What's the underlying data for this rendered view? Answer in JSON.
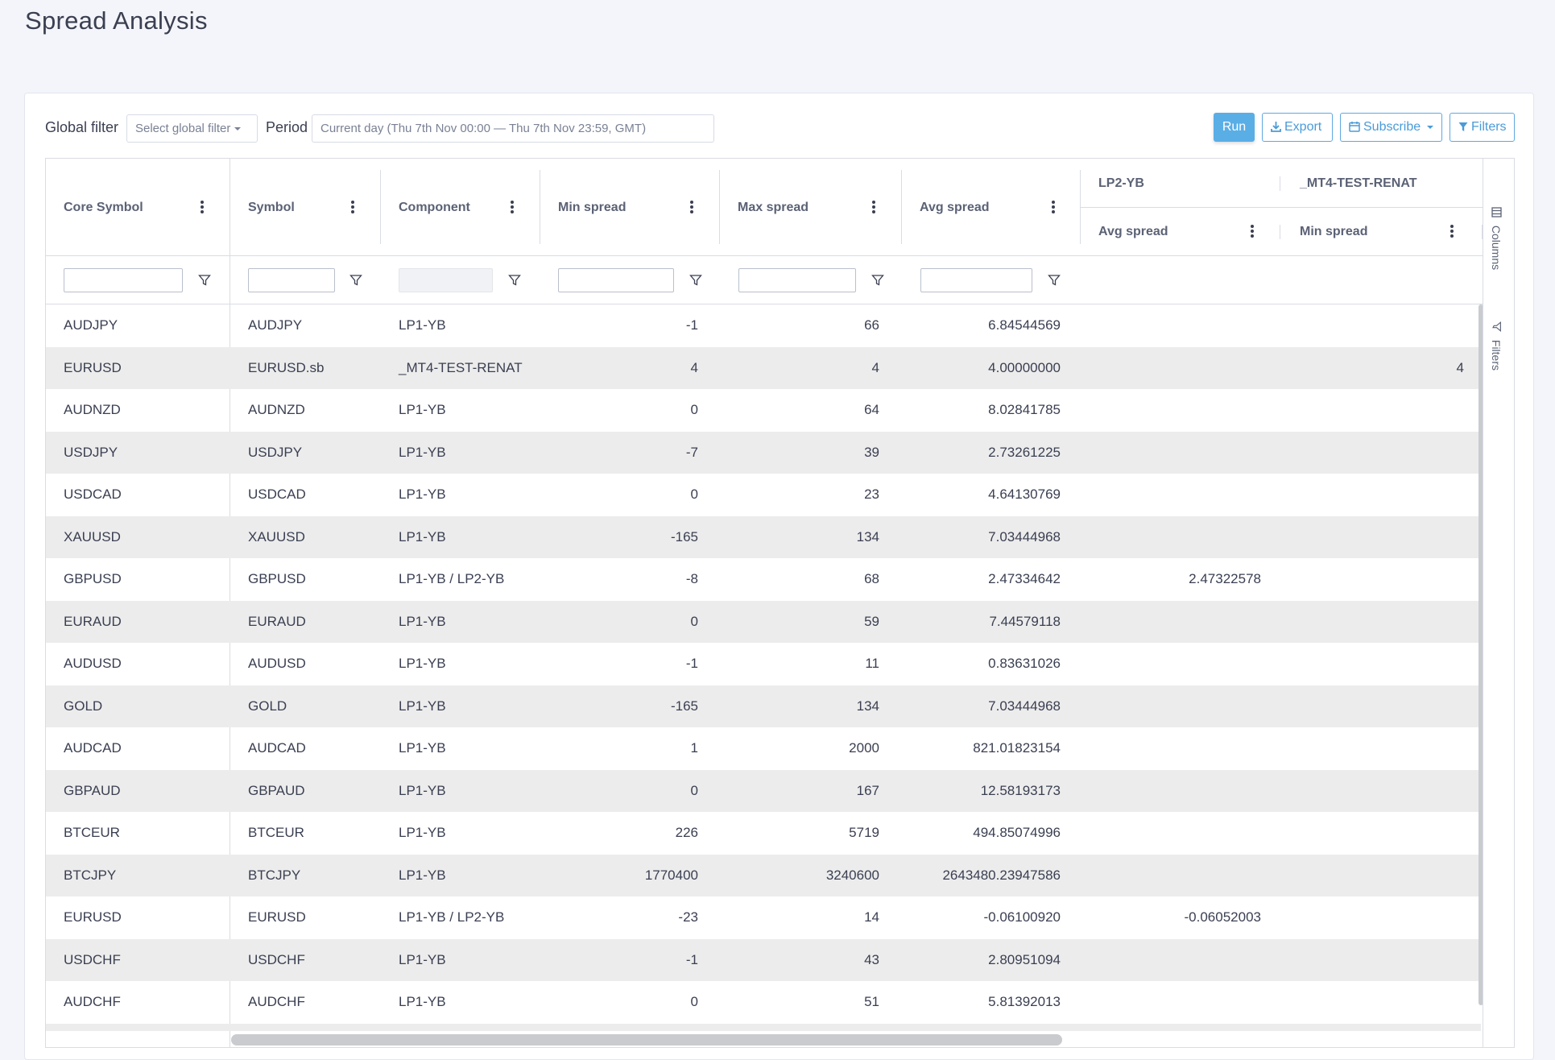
{
  "page": {
    "title": "Spread Analysis"
  },
  "toolbar": {
    "global_filter_label": "Global filter",
    "global_filter_placeholder": "Select global filter",
    "period_label": "Period",
    "period_value": "Current day (Thu 7th Nov 00:00 — Thu 7th Nov 23:59, GMT)",
    "run_label": "Run",
    "export_label": "Export",
    "subscribe_label": "Subscribe",
    "filters_label": "Filters"
  },
  "grid": {
    "columns": {
      "core_symbol": "Core Symbol",
      "symbol": "Symbol",
      "component": "Component",
      "min_spread": "Min spread",
      "max_spread": "Max spread",
      "avg_spread": "Avg spread"
    },
    "groups": [
      {
        "name": "LP2-YB",
        "sub": "Avg spread"
      },
      {
        "name": "_MT4-TEST-RENAT",
        "sub": "Min spread"
      }
    ],
    "side_tabs": {
      "columns": "Columns",
      "filters": "Filters"
    },
    "rows": [
      {
        "core": "AUDJPY",
        "symbol": "AUDJPY",
        "component": "LP1-YB",
        "min": "-1",
        "max": "66",
        "avg": "6.84544569",
        "lp2_avg": "",
        "mt4_min": ""
      },
      {
        "core": "EURUSD",
        "symbol": "EURUSD.sb",
        "component": "_MT4-TEST-RENAT",
        "min": "4",
        "max": "4",
        "avg": "4.00000000",
        "lp2_avg": "",
        "mt4_min": "4"
      },
      {
        "core": "AUDNZD",
        "symbol": "AUDNZD",
        "component": "LP1-YB",
        "min": "0",
        "max": "64",
        "avg": "8.02841785",
        "lp2_avg": "",
        "mt4_min": ""
      },
      {
        "core": "USDJPY",
        "symbol": "USDJPY",
        "component": "LP1-YB",
        "min": "-7",
        "max": "39",
        "avg": "2.73261225",
        "lp2_avg": "",
        "mt4_min": ""
      },
      {
        "core": "USDCAD",
        "symbol": "USDCAD",
        "component": "LP1-YB",
        "min": "0",
        "max": "23",
        "avg": "4.64130769",
        "lp2_avg": "",
        "mt4_min": ""
      },
      {
        "core": "XAUUSD",
        "symbol": "XAUUSD",
        "component": "LP1-YB",
        "min": "-165",
        "max": "134",
        "avg": "7.03444968",
        "lp2_avg": "",
        "mt4_min": ""
      },
      {
        "core": "GBPUSD",
        "symbol": "GBPUSD",
        "component": "LP1-YB / LP2-YB",
        "min": "-8",
        "max": "68",
        "avg": "2.47334642",
        "lp2_avg": "2.47322578",
        "mt4_min": ""
      },
      {
        "core": "EURAUD",
        "symbol": "EURAUD",
        "component": "LP1-YB",
        "min": "0",
        "max": "59",
        "avg": "7.44579118",
        "lp2_avg": "",
        "mt4_min": ""
      },
      {
        "core": "AUDUSD",
        "symbol": "AUDUSD",
        "component": "LP1-YB",
        "min": "-1",
        "max": "11",
        "avg": "0.83631026",
        "lp2_avg": "",
        "mt4_min": ""
      },
      {
        "core": "GOLD",
        "symbol": "GOLD",
        "component": "LP1-YB",
        "min": "-165",
        "max": "134",
        "avg": "7.03444968",
        "lp2_avg": "",
        "mt4_min": ""
      },
      {
        "core": "AUDCAD",
        "symbol": "AUDCAD",
        "component": "LP1-YB",
        "min": "1",
        "max": "2000",
        "avg": "821.01823154",
        "lp2_avg": "",
        "mt4_min": ""
      },
      {
        "core": "GBPAUD",
        "symbol": "GBPAUD",
        "component": "LP1-YB",
        "min": "0",
        "max": "167",
        "avg": "12.58193173",
        "lp2_avg": "",
        "mt4_min": ""
      },
      {
        "core": "BTCEUR",
        "symbol": "BTCEUR",
        "component": "LP1-YB",
        "min": "226",
        "max": "5719",
        "avg": "494.85074996",
        "lp2_avg": "",
        "mt4_min": ""
      },
      {
        "core": "BTCJPY",
        "symbol": "BTCJPY",
        "component": "LP1-YB",
        "min": "1770400",
        "max": "3240600",
        "avg": "2643480.23947586",
        "lp2_avg": "",
        "mt4_min": ""
      },
      {
        "core": "EURUSD",
        "symbol": "EURUSD",
        "component": "LP1-YB / LP2-YB",
        "min": "-23",
        "max": "14",
        "avg": "-0.06100920",
        "lp2_avg": "-0.06052003",
        "mt4_min": ""
      },
      {
        "core": "USDCHF",
        "symbol": "USDCHF",
        "component": "LP1-YB",
        "min": "-1",
        "max": "43",
        "avg": "2.80951094",
        "lp2_avg": "",
        "mt4_min": ""
      },
      {
        "core": "AUDCHF",
        "symbol": "AUDCHF",
        "component": "LP1-YB",
        "min": "0",
        "max": "51",
        "avg": "5.81392013",
        "lp2_avg": "",
        "mt4_min": ""
      }
    ]
  }
}
